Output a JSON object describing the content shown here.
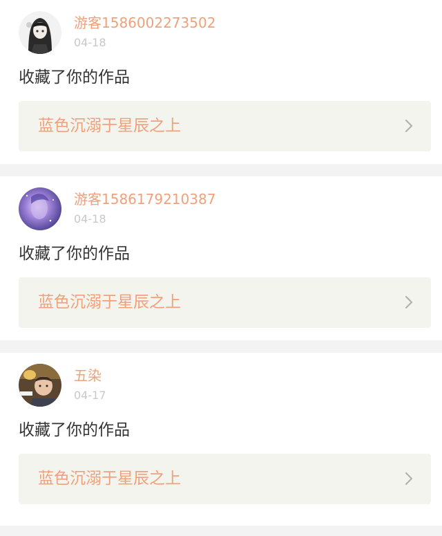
{
  "notifications": [
    {
      "username": "游客1586002273502",
      "date": "04-18",
      "action": "收藏了你的作品",
      "work_title": "蓝色沉溺于星辰之上",
      "avatar_icon": "anime-girl-avatar-icon"
    },
    {
      "username": "游客1586179210387",
      "date": "04-18",
      "action": "收藏了你的作品",
      "work_title": "蓝色沉溺于星辰之上",
      "avatar_icon": "purple-galaxy-avatar-icon"
    },
    {
      "username": "五染",
      "date": "04-17",
      "action": "收藏了你的作品",
      "work_title": "蓝色沉溺于星辰之上",
      "avatar_icon": "child-photo-avatar-icon"
    }
  ],
  "colors": {
    "accent": "#f0a07a",
    "date_gray": "#c8c8c8",
    "body_text": "#333333",
    "link_bg": "#f4f4ef",
    "page_bg": "#f3f3f3"
  }
}
